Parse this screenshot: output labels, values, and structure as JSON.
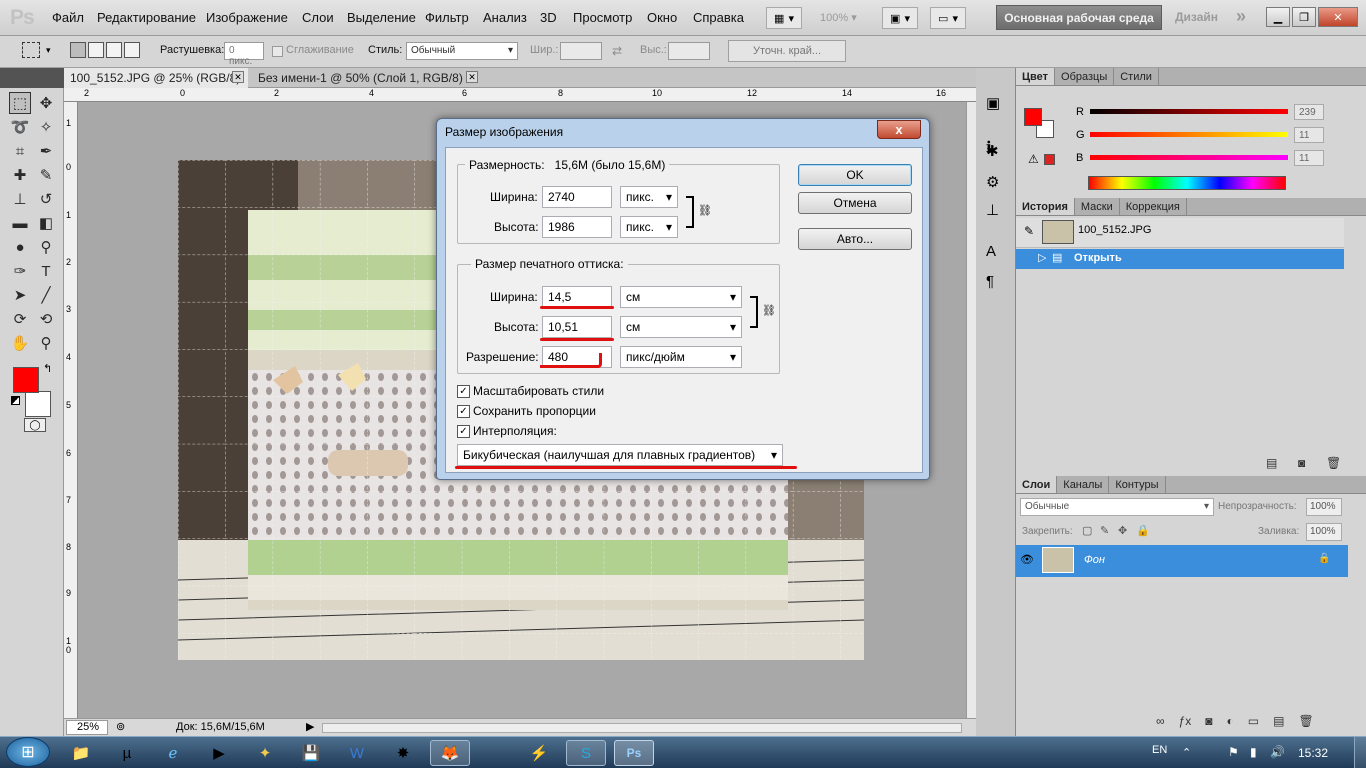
{
  "app": {
    "logo": "Ps"
  },
  "menu": [
    "Файл",
    "Редактирование",
    "Изображение",
    "Слои",
    "Выделение",
    "Фильтр",
    "Анализ",
    "3D",
    "Просмотр",
    "Окно",
    "Справка"
  ],
  "menubar_extra": {
    "zoom": "100%",
    "workspace": "Основная рабочая среда",
    "design": "Дизайн",
    "more": "»"
  },
  "options": {
    "feather_label": "Растушевка:",
    "feather_value": "0 пикс.",
    "antialias_label": "Сглаживание",
    "style_label": "Стиль:",
    "style_value": "Обычный",
    "width_label": "Шир.:",
    "height_label": "Выс.:",
    "refine_edge": "Уточн. край..."
  },
  "tabs": [
    {
      "label": "100_5152.JPG @ 25% (RGB/8)"
    },
    {
      "label": "Без имени-1 @ 50% (Слой 1, RGB/8) *"
    }
  ],
  "ruler_top": [
    "2",
    "0",
    "2",
    "4",
    "6",
    "8",
    "10",
    "12",
    "14",
    "16"
  ],
  "ruler_left": [
    "1",
    "0",
    "1",
    "2",
    "3",
    "4",
    "5",
    "6",
    "7",
    "8",
    "9",
    "1 0",
    "1 1"
  ],
  "status": {
    "zoom": "25%",
    "doc": "Док: 15,6M/15,6M"
  },
  "colors": {
    "foreground": "#ff0000",
    "background": "#ffffff"
  },
  "color_panel": {
    "tabs": [
      "Цвет",
      "Образцы",
      "Стили"
    ],
    "r_label": "R",
    "r_value": "239",
    "g_label": "G",
    "g_value": "11",
    "b_label": "B",
    "b_value": "11"
  },
  "history_panel": {
    "tabs": [
      "История",
      "Маски",
      "Коррекция"
    ],
    "snapshot": "100_5152.JPG",
    "step": "Открыть"
  },
  "layers_panel": {
    "tabs": [
      "Слои",
      "Каналы",
      "Контуры"
    ],
    "blend": "Обычные",
    "opacity_label": "Непрозрачность:",
    "opacity_value": "100%",
    "lock_label": "Закрепить:",
    "fill_label": "Заливка:",
    "fill_value": "100%",
    "layer_name": "Фон"
  },
  "dialog": {
    "title": "Размер изображения",
    "close": "x",
    "dimensions_label": "Размерность:",
    "dimensions_value": "15,6M (было 15,6M)",
    "pixel_width_label": "Ширина:",
    "pixel_width_value": "2740",
    "pixel_width_unit": "пикс.",
    "pixel_height_label": "Высота:",
    "pixel_height_value": "1986",
    "pixel_height_unit": "пикс.",
    "print_group": "Размер печатного оттиска:",
    "doc_width_label": "Ширина:",
    "doc_width_value": "14,5",
    "doc_width_unit": "см",
    "doc_height_label": "Высота:",
    "doc_height_value": "10,51",
    "doc_height_unit": "см",
    "resolution_label": "Разрешение:",
    "resolution_value": "480",
    "resolution_unit": "пикс/дюйм",
    "ok": "OK",
    "cancel": "Отмена",
    "auto": "Авто...",
    "scale_styles": "Масштабировать стили",
    "constrain": "Сохранить пропорции",
    "resample": "Интерполяция:",
    "resample_method": "Бикубическая (наилучшая для плавных градиентов)"
  },
  "taskbar": {
    "lang": "EN",
    "time": "15:32"
  }
}
